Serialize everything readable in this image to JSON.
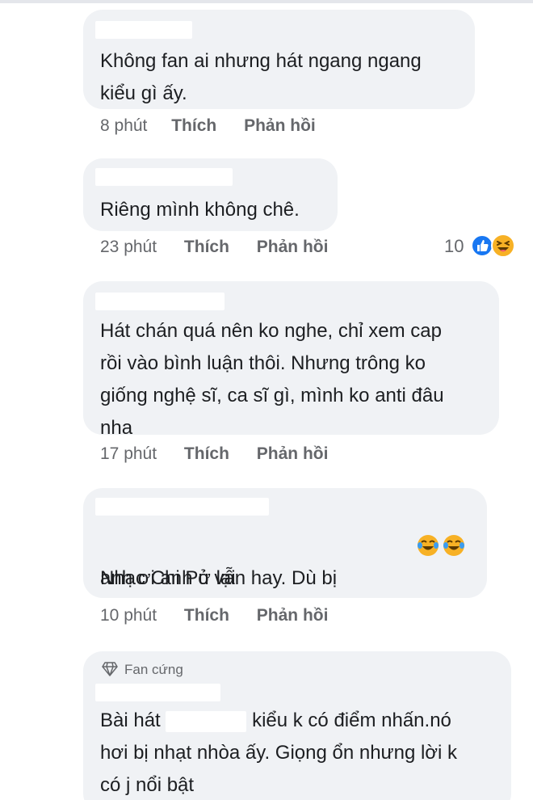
{
  "comments": [
    {
      "text": "Không fan ai nhưng hát ngang ngang\nkiểu gì ấy.",
      "time": "8 phút",
      "like": "Thích",
      "reply": "Phản hồi"
    },
    {
      "text": "Riêng mình không chê.",
      "time": "23 phút",
      "like": "Thích",
      "reply": "Phản hồi",
      "reaction_count": "10",
      "reaction_icons": [
        "like-icon",
        "laugh-icon"
      ]
    },
    {
      "text": "Hát chán quá nên ko nghe, chỉ xem cap\nrồi vào bình luận thôi. Nhưng trông ko\ngiống nghệ sĩ, ca sĩ gì, mình ko anti đâu\nnha",
      "time": "17 phút",
      "like": "Thích",
      "reply": "Phản hồi"
    },
    {
      "text_before": "Nhạc Chi Pu vẫn hay. Dù bị",
      "text_line2": "anh ơi anh ở lại",
      "emoji_icons": [
        "tears-of-joy-icon",
        "tears-of-joy-icon"
      ],
      "time": "10 phút",
      "like": "Thích",
      "reply": "Phản hồi"
    },
    {
      "badge": "Fan cứng",
      "badge_icon": "diamond-icon",
      "text_before": "Bài hát",
      "text_after": "kiểu k có điểm nhấn.nó",
      "text_rest": "hơi bị nhạt nhòa ấy. Giọng ổn nhưng lời k\ncó j nổi bật"
    }
  ],
  "colors": {
    "bubble": "#f0f2f5",
    "meta": "#65676b",
    "like_blue": "#1877f2",
    "emoji_yellow": "#f7b125"
  }
}
